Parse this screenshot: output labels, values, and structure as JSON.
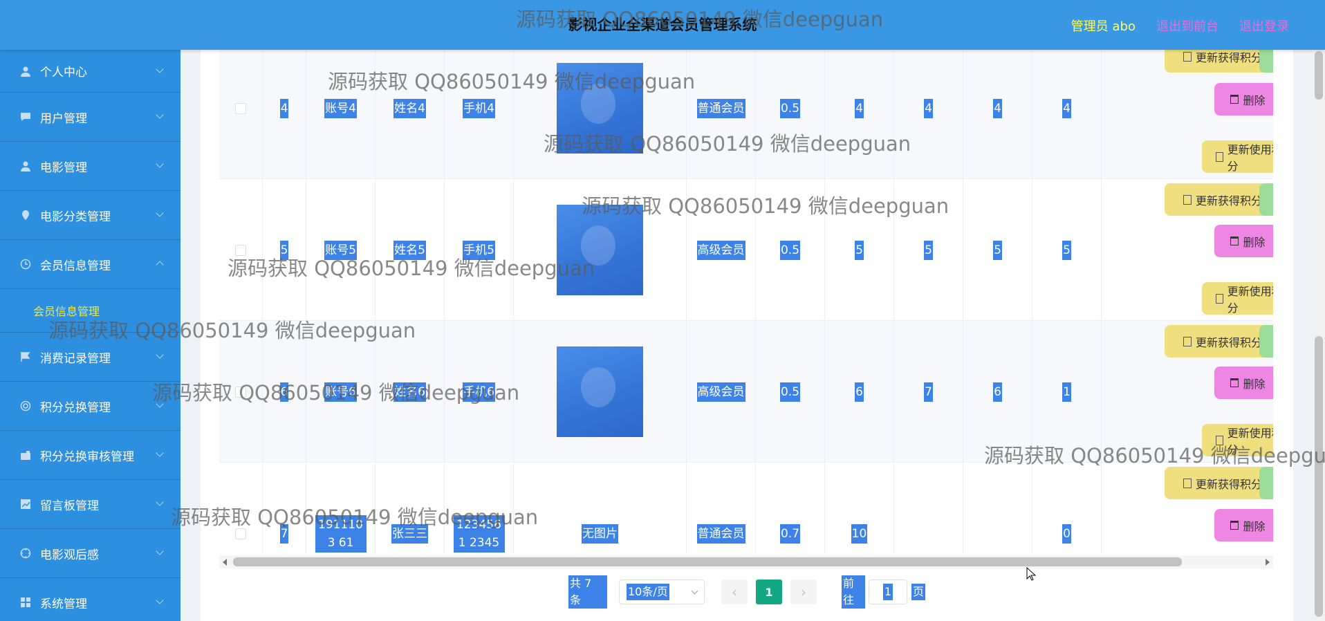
{
  "header": {
    "title": "影视企业全渠道会员管理系统",
    "admin": "管理员 abo",
    "to_front": "退出到前台",
    "logout": "退出登录"
  },
  "sidebar": {
    "items": [
      {
        "label": "个人中心",
        "icon": "user-icon"
      },
      {
        "label": "用户管理",
        "icon": "chat-icon"
      },
      {
        "label": "电影管理",
        "icon": "user-icon"
      },
      {
        "label": "电影分类管理",
        "icon": "location-icon"
      },
      {
        "label": "会员信息管理",
        "icon": "clock-icon",
        "expanded": true
      },
      {
        "label": "消费记录管理",
        "icon": "flag-icon"
      },
      {
        "label": "积分兑换管理",
        "icon": "target-icon"
      },
      {
        "label": "积分兑换审核管理",
        "icon": "camera-icon"
      },
      {
        "label": "留言板管理",
        "icon": "chart-icon"
      },
      {
        "label": "电影观后感",
        "icon": "compass-icon"
      },
      {
        "label": "系统管理",
        "icon": "grid-icon"
      }
    ],
    "submenu_label": "会员信息管理"
  },
  "table": {
    "rows": [
      {
        "id": "4",
        "account": "账号4",
        "name": "姓名4",
        "phone": "手机4",
        "image": "photo",
        "level": "普通会员",
        "discount": "0.5",
        "c1": "4",
        "c2": "4",
        "c3": "4",
        "c4": "4"
      },
      {
        "id": "5",
        "account": "账号5",
        "name": "姓名5",
        "phone": "手机5",
        "image": "photo",
        "level": "高级会员",
        "discount": "0.5",
        "c1": "5",
        "c2": "5",
        "c3": "5",
        "c4": "5"
      },
      {
        "id": "6",
        "account": "账号6",
        "name": "姓名6",
        "phone": "手机6",
        "image": "photo",
        "level": "高级会员",
        "discount": "0.5",
        "c1": "6",
        "c2": "7",
        "c3": "6",
        "c4": "1"
      },
      {
        "id": "7",
        "account": "1911103 61",
        "name": "张三三",
        "phone": "1234561 2345",
        "image": "无图片",
        "level": "普通会员",
        "discount": "0.7",
        "c1": "10",
        "c2": "",
        "c3": "",
        "c4": "0"
      }
    ],
    "actions": {
      "update_used": "更新使用积分",
      "update_gained": "更新获得积分",
      "delete": "删除"
    }
  },
  "pagination": {
    "total": "共 7 条",
    "page_size": "10条/页",
    "current_page": "1",
    "goto_prefix": "前往",
    "goto_value": "1",
    "goto_suffix": "页"
  },
  "watermark": "源码获取 QQ86050149 微信deepguan"
}
